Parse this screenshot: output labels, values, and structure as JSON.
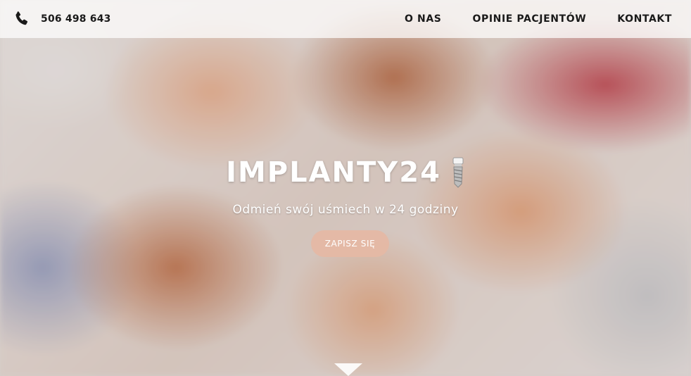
{
  "header": {
    "phone_icon": "phone-handset-icon",
    "phone_number": "506 498 643",
    "nav": {
      "items": [
        {
          "label": "O NAS"
        },
        {
          "label": "OPINIE PACJENTÓW"
        },
        {
          "label": "KONTAKT"
        }
      ]
    }
  },
  "hero": {
    "title": "IMPLANTY24",
    "title_icon": "dental-implant-icon",
    "tagline": "Odmień swój uśmiech w 24 godziny",
    "cta_label": "ZAPISZ SIĘ",
    "scroll_icon": "scroll-down-arrow-icon"
  },
  "colors": {
    "cta_background": "#e5b8a4",
    "header_background": "#ffffff",
    "text_dark": "#1a1a1a",
    "text_light": "#ffffff"
  }
}
